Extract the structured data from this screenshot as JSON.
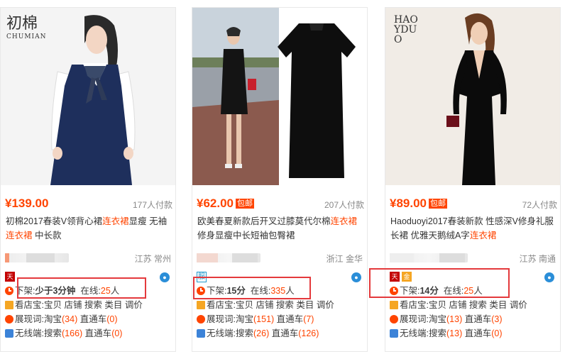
{
  "products": [
    {
      "brand_logo": {
        "zh": "初棉",
        "en": "CHUMIAN"
      },
      "price": "¥139.00",
      "free_shipping": "",
      "sales": "177人付款",
      "title_parts": [
        "初棉2017春装V领背心裙",
        "连衣裙",
        "显瘦 无袖",
        "连衣裙",
        " 中长款"
      ],
      "location": "江苏 常州",
      "badge": "天猫",
      "offline_label": "下架:",
      "offline_time": "少于3分钟",
      "online_label": "在线:",
      "online_count": "25",
      "online_unit": "人",
      "row2_label": "看店宝:",
      "row2_links": "宝贝 店铺 搜索 类目 调价",
      "row3_label": "展现词:",
      "row3_taobao": "淘宝",
      "row3_taobao_count": "(34)",
      "row3_ztc": "直通车",
      "row3_ztc_count": "(0)",
      "row4_label": "无线端:",
      "row4_search": "搜索",
      "row4_search_count": "(166)",
      "row4_ztc": "直通车",
      "row4_ztc_count": "(0)"
    },
    {
      "brand_logo": {
        "zh": "",
        "en": ""
      },
      "price": "¥62.00",
      "free_shipping": "包邮",
      "sales": "207人付款",
      "title_parts": [
        "欧美春夏新款后开叉过膝莫代尔棉",
        "连衣裙",
        "修身显瘦中长短袖包臀裙",
        "",
        ""
      ],
      "location": "浙江 金华",
      "badge": "服",
      "offline_label": "下架:",
      "offline_time": "15分",
      "online_label": "在线:",
      "online_count": "335",
      "online_unit": "人",
      "row2_label": "看店宝:",
      "row2_links": "宝贝 店铺 搜索 类目 调价",
      "row3_label": "展现词:",
      "row3_taobao": "淘宝",
      "row3_taobao_count": "(151)",
      "row3_ztc": "直通车",
      "row3_ztc_count": "(7)",
      "row4_label": "无线端:",
      "row4_search": "搜索",
      "row4_search_count": "(26)",
      "row4_ztc": "直通车",
      "row4_ztc_count": "(126)"
    },
    {
      "brand_logo": {
        "zh": "HAOYDUO",
        "en": ""
      },
      "price": "¥89.00",
      "free_shipping": "包邮",
      "sales": "72人付款",
      "title_parts": [
        "Haoduoyi2017春装新款 性感深V修身礼服长裙 优雅天鹅绒A字",
        "连衣裙",
        "",
        "",
        ""
      ],
      "location": "江苏 南通",
      "badge": "天猫",
      "offline_label": "下架:",
      "offline_time": "14分",
      "online_label": "在线:",
      "online_count": "25",
      "online_unit": "人",
      "row2_label": "看店宝:",
      "row2_links": "宝贝 店铺 搜索 类目 调价",
      "row3_label": "展现词:",
      "row3_taobao": "淘宝",
      "row3_taobao_count": "(13)",
      "row3_ztc": "直通车",
      "row3_ztc_count": "(3)",
      "row4_label": "无线端:",
      "row4_search": "搜索",
      "row4_search_count": "(13)",
      "row4_ztc": "直通车",
      "row4_ztc_count": "(0)"
    }
  ],
  "colors": {
    "price": "#ff4400",
    "highlight_box": "#e4393c",
    "link_count": "#ff4400"
  },
  "icons": [
    "clock-icon",
    "mail-icon",
    "location-pin-icon",
    "phone-icon",
    "tmall-icon",
    "wangwang-icon"
  ]
}
